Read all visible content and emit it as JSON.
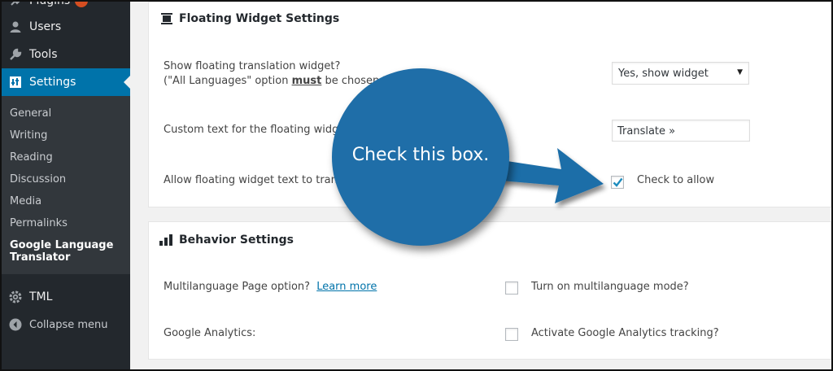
{
  "sidebar": {
    "items": [
      {
        "label": "Plugins",
        "icon": "plugin-icon"
      },
      {
        "label": "Users",
        "icon": "user-icon"
      },
      {
        "label": "Tools",
        "icon": "wrench-icon"
      },
      {
        "label": "Settings",
        "icon": "settings-icon"
      },
      {
        "label": "TML",
        "icon": "gear-icon"
      },
      {
        "label": "Collapse menu",
        "icon": "collapse-icon"
      }
    ],
    "submenu": [
      "General",
      "Writing",
      "Reading",
      "Discussion",
      "Media",
      "Permalinks"
    ],
    "submenu_current_line1": "Google Language",
    "submenu_current_line2": "Translator",
    "accent_color": "#0073aa"
  },
  "floating": {
    "title": "Floating Widget Settings",
    "show_label_line1": "Show floating translation widget?",
    "show_label_line2_a": "(\"All Languages\" option ",
    "show_label_line2_b": "must",
    "show_label_line2_c": " be chosen to",
    "show_select_value": "Yes, show widget",
    "custom_text_label": "Custom text for the floating widge",
    "custom_text_value": "Translate »",
    "allow_label": "Allow floating widget text to trans",
    "allow_checkbox_label": "Check to allow"
  },
  "behavior": {
    "title": "Behavior Settings",
    "multi_label": "Multilanguage Page option?",
    "multi_link": "Learn more",
    "multi_checkbox_label": "Turn on multilanguage mode?",
    "ga_label": "Google Analytics:",
    "ga_checkbox_label": "Activate Google Analytics tracking?"
  },
  "callout": {
    "text": "Check this box.",
    "color": "#1f6ea8"
  }
}
